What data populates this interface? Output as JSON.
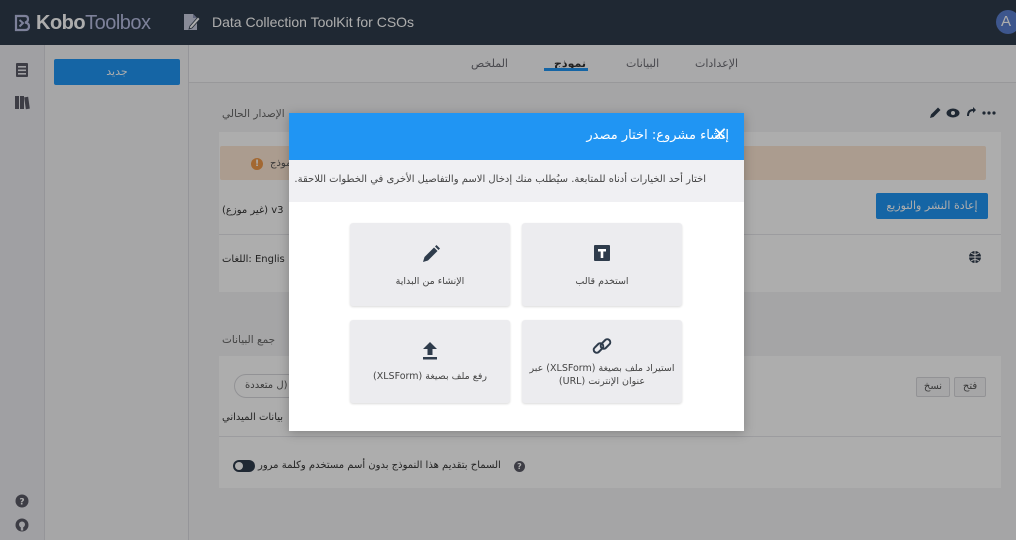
{
  "header": {
    "logo_kobo": "Kobo",
    "logo_toolbox": "Toolbox",
    "project_title": "Data Collection ToolKit for CSOs",
    "avatar_letter": "A"
  },
  "drawer": {
    "new_button": "جديد"
  },
  "tabs": [
    {
      "label": "الإعدادات"
    },
    {
      "label": "البيانات"
    },
    {
      "label": "نموذج"
    },
    {
      "label": "الملخص"
    }
  ],
  "page": {
    "current_version_label": "الإصدار الحالي",
    "warning_text": "نموذج",
    "version_text": "(غير موزع) v3",
    "redeploy_button": "إعادة النشر والتوزيع",
    "languages_text": "اللغات: Englis",
    "data_collection_label": "جمع البيانات",
    "select_value": "ل متعددة)",
    "open_pill": "فتح",
    "copy_pill": "نسخ",
    "field_text": "بيانات الميداني",
    "allow_anonymous": "السماح بتقديم هذا النموذج بدون أسم مستخدم وكلمة مرور"
  },
  "modal": {
    "title": "إنشاء مشروع: اختار مصدر",
    "close": "✕",
    "subtitle": "اختار أحد الخيارات أدناه للمتابعة. سيُطلب منك إدخال الاسم والتفاصيل الأخرى في الخطوات اللاحقة.",
    "options": [
      {
        "label": "استخدم قالب",
        "icon": "template-icon"
      },
      {
        "label": "الإنشاء من البداية",
        "icon": "pencil-icon"
      },
      {
        "label": "استيراد ملف بصيغة (XLSForm) عبر عنوان الإنترنت (URL)",
        "icon": "link-icon"
      },
      {
        "label": "رفع ملف بصيغة (XLSForm)",
        "icon": "upload-icon"
      }
    ]
  },
  "colors": {
    "header_bg": "#2f3c4c",
    "accent": "#2095f3",
    "warning_bg": "#fde6d3"
  }
}
